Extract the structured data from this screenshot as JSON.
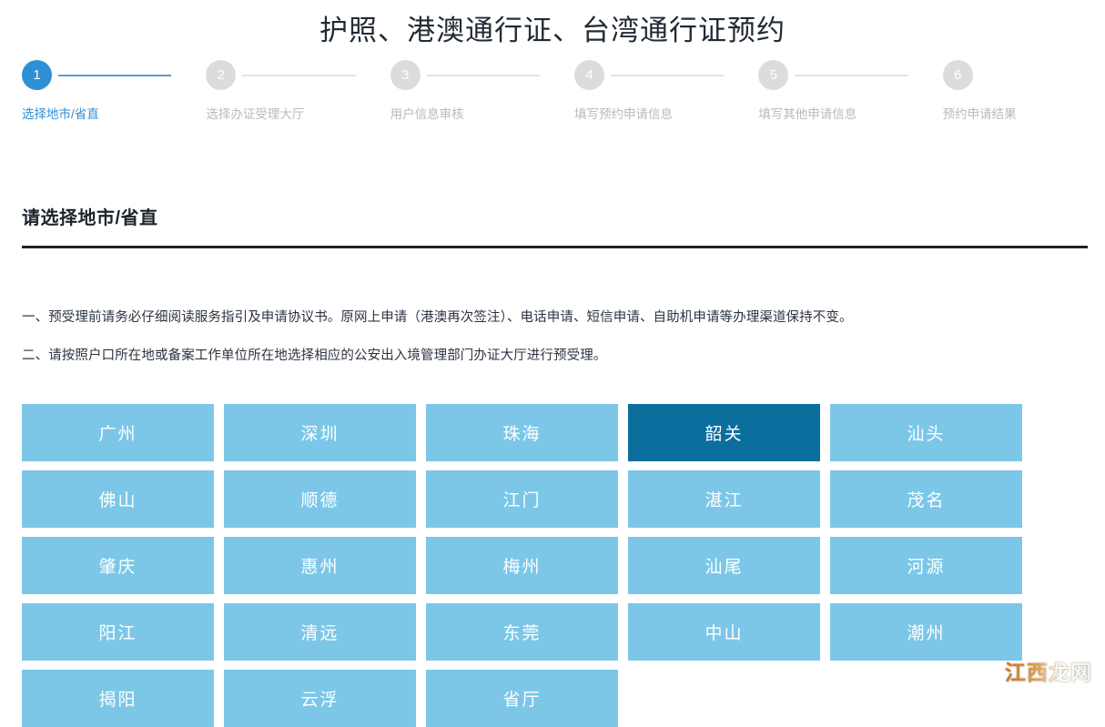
{
  "page": {
    "title": "护照、港澳通行证、台湾通行证预约"
  },
  "stepper": {
    "current_step": 1,
    "active_color": "#2f8fd4",
    "inactive_color": "#dcdcdc",
    "steps": [
      {
        "number": "1",
        "label": "选择地市/省直"
      },
      {
        "number": "2",
        "label": "选择办证受理大厅"
      },
      {
        "number": "3",
        "label": "用户信息审核"
      },
      {
        "number": "4",
        "label": "填写预约申请信息"
      },
      {
        "number": "5",
        "label": "填写其他申请信息"
      },
      {
        "number": "6",
        "label": "预约申请结果"
      }
    ]
  },
  "section": {
    "heading": "请选择地市/省直"
  },
  "notices": [
    "一、预受理前请务必仔细阅读服务指引及申请协议书。原网上申请（港澳再次签注）、电话申请、短信申请、自助机申请等办理渠道保持不变。",
    "二、请按照户口所在地或备案工作单位所在地选择相应的公安出入境管理部门办证大厅进行预受理。"
  ],
  "city_grid": {
    "tile_color": "#7cc7e8",
    "selected_color": "#0b6e9d",
    "selected_city": "韶关",
    "cities": [
      {
        "name": "广州",
        "selected": false
      },
      {
        "name": "深圳",
        "selected": false
      },
      {
        "name": "珠海",
        "selected": false
      },
      {
        "name": "韶关",
        "selected": true
      },
      {
        "name": "汕头",
        "selected": false
      },
      {
        "name": "佛山",
        "selected": false
      },
      {
        "name": "顺德",
        "selected": false
      },
      {
        "name": "江门",
        "selected": false
      },
      {
        "name": "湛江",
        "selected": false
      },
      {
        "name": "茂名",
        "selected": false
      },
      {
        "name": "肇庆",
        "selected": false
      },
      {
        "name": "惠州",
        "selected": false
      },
      {
        "name": "梅州",
        "selected": false
      },
      {
        "name": "汕尾",
        "selected": false
      },
      {
        "name": "河源",
        "selected": false
      },
      {
        "name": "阳江",
        "selected": false
      },
      {
        "name": "清远",
        "selected": false
      },
      {
        "name": "东莞",
        "selected": false
      },
      {
        "name": "中山",
        "selected": false
      },
      {
        "name": "潮州",
        "selected": false
      },
      {
        "name": "揭阳",
        "selected": false
      },
      {
        "name": "云浮",
        "selected": false
      },
      {
        "name": "省厅",
        "selected": false
      }
    ]
  },
  "watermark": {
    "text": "江西龙网"
  }
}
